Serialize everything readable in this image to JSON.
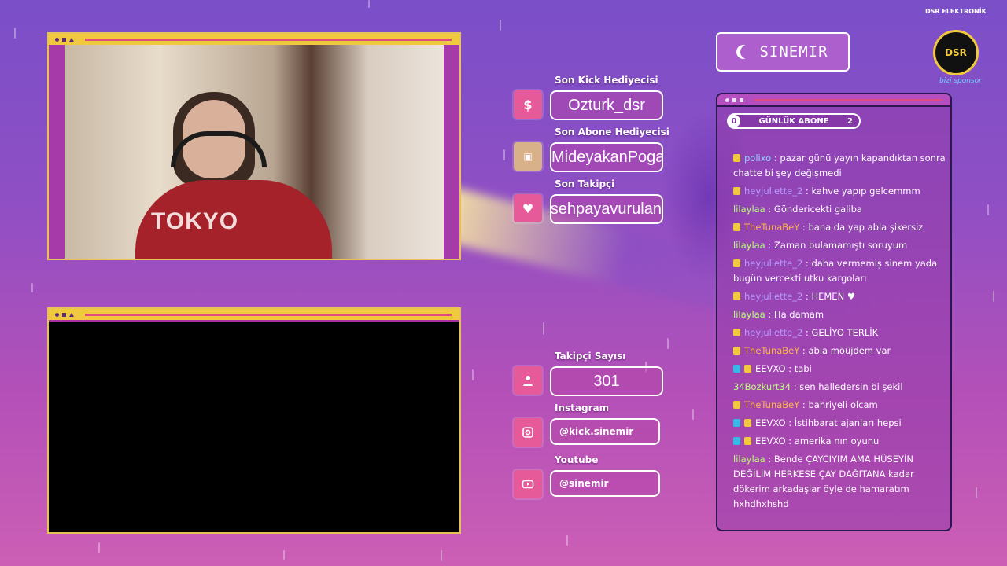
{
  "brand": {
    "name": "SINEMIR",
    "icon": "moon-icon"
  },
  "sponsor_logo": {
    "top_text": "DSR ELEKTRONİK",
    "center_text": "DSR",
    "sponsor_text": "bizi sponsor"
  },
  "widgets": {
    "kick_gift": {
      "label": "Son Kick Hediyecisi",
      "value": "Ozturk_dsr",
      "icon": "dollar-icon"
    },
    "sub_gift": {
      "label": "Son Abone Hediyecisi",
      "value": "MideyakanPogaca",
      "icon": "gift-icon"
    },
    "follower": {
      "label": "Son Takipçi",
      "value": "sehpayavurulan",
      "icon": "heart-icon"
    },
    "follower_count": {
      "label": "Takipçi Sayısı",
      "value": "301",
      "icon": "user-icon"
    },
    "instagram": {
      "label": "Instagram",
      "value": "@kick.sinemir",
      "icon": "instagram-icon"
    },
    "youtube": {
      "label": "Youtube",
      "value": "@sinemir",
      "icon": "youtube-icon"
    }
  },
  "webcam": {
    "shirt_text": "TOKYO"
  },
  "chat": {
    "sub_goal": {
      "label": "GÜNLÜK ABONE",
      "current": "0",
      "target": "2"
    },
    "messages": [
      {
        "user": "polixo",
        "color": "#8fd0ff",
        "badge": "sub",
        "text": "pazar günü yayın kapandıktan sonra chatte bi şey değişmedi"
      },
      {
        "user": "heyjuliette_2",
        "color": "#b69bff",
        "badge": "sub",
        "text": "kahve yapıp gelcemmm"
      },
      {
        "user": "lilaylaa",
        "color": "#b8ff7a",
        "badge": "",
        "text": "Göndericekti galiba"
      },
      {
        "user": "TheTunaBeY",
        "color": "#ffb84a",
        "badge": "sub",
        "text": "bana da yap abla şikersiz"
      },
      {
        "user": "lilaylaa",
        "color": "#b8ff7a",
        "badge": "",
        "text": "Zaman bulamamıştı soruyum"
      },
      {
        "user": "heyjuliette_2",
        "color": "#b69bff",
        "badge": "sub",
        "text": "daha vermemiş sinem yada bugün vercekti utku kargoları"
      },
      {
        "user": "heyjuliette_2",
        "color": "#b69bff",
        "badge": "sub",
        "text": "HEMEN ♥"
      },
      {
        "user": "lilaylaa",
        "color": "#b8ff7a",
        "badge": "",
        "text": "Ha damam"
      },
      {
        "user": "heyjuliette_2",
        "color": "#b69bff",
        "badge": "sub",
        "text": "GELİYO TERLİK"
      },
      {
        "user": "TheTunaBeY",
        "color": "#ffb84a",
        "badge": "sub",
        "text": "abla möüjdem var"
      },
      {
        "user": "EEVXO",
        "color": "#ffffff",
        "badge": "cube",
        "text": "tabi"
      },
      {
        "user": "34Bozkurt34",
        "color": "#b8ff7a",
        "badge": "",
        "text": "sen halledersin bi şekil"
      },
      {
        "user": "TheTunaBeY",
        "color": "#ffb84a",
        "badge": "sub",
        "text": "bahriyeli olcam"
      },
      {
        "user": "EEVXO",
        "color": "#ffffff",
        "badge": "cube",
        "text": "İstihbarat ajanları hepsi"
      },
      {
        "user": "EEVXO",
        "color": "#ffffff",
        "badge": "cube",
        "text": "amerika nın oyunu"
      },
      {
        "user": "lilaylaa",
        "color": "#b8ff7a",
        "badge": "",
        "text": "Bende ÇAYCIYIM AMA HÜSEYİN DEĞİLİM HERKESE ÇAY DAĞITANA kadar dökerim arkadaşlar öyle de hamaratım hxhdhxhshd"
      }
    ]
  }
}
